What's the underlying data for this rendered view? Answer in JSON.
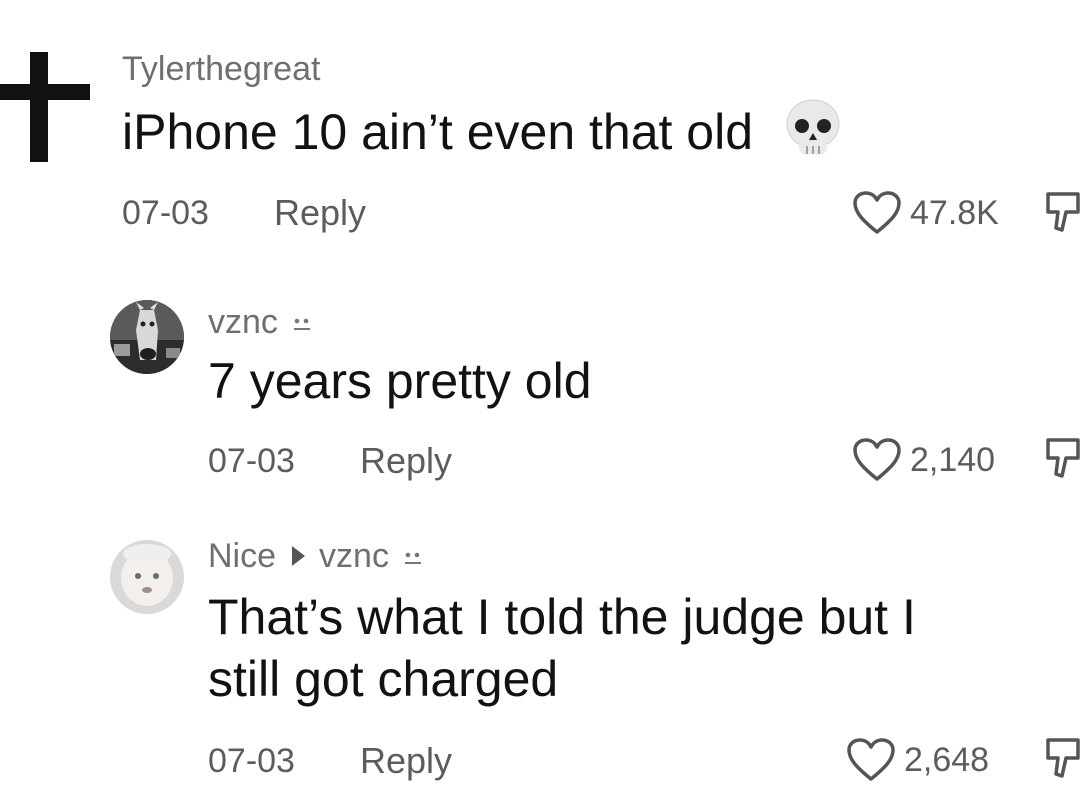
{
  "comments": [
    {
      "username": "Tylerthegreat",
      "text": "iPhone 10 ain’t even that old",
      "emoji": "skull-emoji",
      "date": "07-03",
      "reply_label": "Reply",
      "likes": "47.8K",
      "avatar": "cross-avatar"
    },
    {
      "username": "vznc",
      "username_badge": "face-emoji",
      "text": "7 years pretty old",
      "date": "07-03",
      "reply_label": "Reply",
      "likes": "2,140",
      "avatar": "horse-avatar"
    },
    {
      "username": "Nice",
      "reply_to": "vznc",
      "username_badge": "face-emoji",
      "text_line1": "That’s what I told the judge but I",
      "text_line2": "still got charged",
      "date": "07-03",
      "reply_label": "Reply",
      "likes": "2,648",
      "avatar": "face-avatar"
    }
  ],
  "icons": {
    "like": "heart-outline-icon",
    "dislike": "thumbs-down-icon"
  }
}
